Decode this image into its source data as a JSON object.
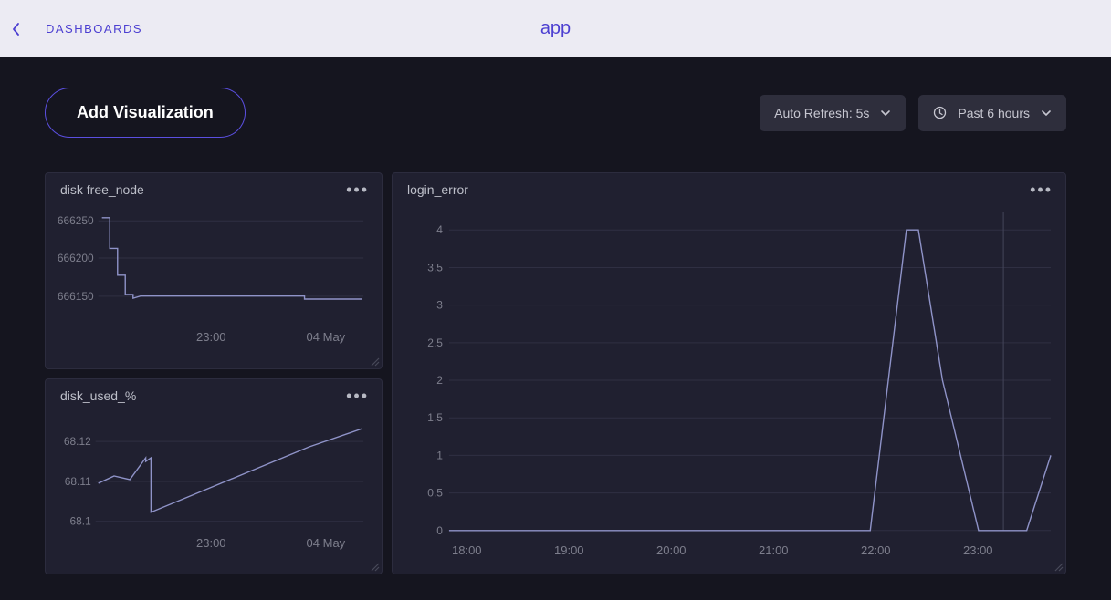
{
  "header": {
    "breadcrumb": "DASHBOARDS",
    "app_title": "app"
  },
  "toolbar": {
    "add_viz_label": "Add Visualization",
    "auto_refresh_label": "Auto Refresh: 5s",
    "time_range_label": "Past 6 hours"
  },
  "panels": {
    "disk_free": {
      "title": "disk free_node",
      "xticks": [
        "23:00",
        "04 May"
      ],
      "chart_data": {
        "type": "line",
        "ylabel": "",
        "xlabel": "",
        "ylim": [
          666130,
          666260
        ],
        "yticks": [
          666250,
          666200,
          666150
        ],
        "x": [
          0,
          3,
          3,
          6,
          6,
          9,
          9,
          12,
          12,
          15,
          54,
          78,
          78,
          100
        ],
        "y": [
          666250,
          666250,
          666210,
          666210,
          666175,
          666175,
          666150,
          666150,
          666145,
          666148,
          666148,
          666148,
          666144,
          666144
        ]
      }
    },
    "disk_used": {
      "title": "disk_used_%",
      "xticks": [
        "23:00",
        "04 May"
      ],
      "chart_data": {
        "type": "line",
        "ylabel": "",
        "xlabel": "",
        "ylim": [
          68.095,
          68.125
        ],
        "yticks": [
          68.12,
          68.11,
          68.1
        ],
        "x": [
          0,
          6,
          12,
          18,
          18,
          20,
          20,
          40,
          60,
          80,
          100
        ],
        "y": [
          68.108,
          68.11,
          68.109,
          68.115,
          68.114,
          68.115,
          68.1,
          68.106,
          68.112,
          68.118,
          68.123
        ]
      }
    },
    "login_error": {
      "title": "login_error",
      "xticks": [
        "18:00",
        "19:00",
        "20:00",
        "21:00",
        "22:00",
        "23:00"
      ],
      "chart_data": {
        "type": "line",
        "ylabel": "",
        "xlabel": "",
        "ylim": [
          0,
          4
        ],
        "yticks": [
          4,
          3.5,
          3,
          2.5,
          2,
          1.5,
          1,
          0.5,
          0
        ],
        "x": [
          0,
          70,
          76,
          78,
          82,
          88,
          96,
          100
        ],
        "y": [
          0,
          0,
          4,
          4,
          2,
          0,
          0,
          1
        ]
      }
    }
  }
}
